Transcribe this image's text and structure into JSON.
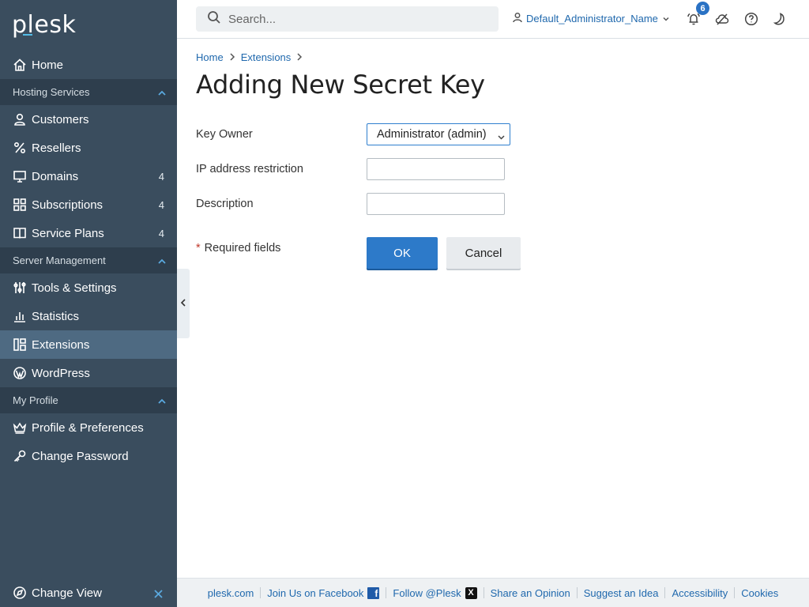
{
  "brand": {
    "logo_text": "plesk"
  },
  "sidebar": {
    "home": "Home",
    "sections": [
      {
        "label": "Hosting Services"
      },
      {
        "label": "Server Management"
      },
      {
        "label": "My Profile"
      }
    ],
    "hosting_items": [
      {
        "label": "Customers",
        "icon": "user-icon"
      },
      {
        "label": "Resellers",
        "icon": "percent-icon"
      },
      {
        "label": "Domains",
        "icon": "monitor-icon",
        "count": "4"
      },
      {
        "label": "Subscriptions",
        "icon": "grid-icon",
        "count": "4"
      },
      {
        "label": "Service Plans",
        "icon": "book-icon",
        "count": "4"
      }
    ],
    "server_items": [
      {
        "label": "Tools & Settings",
        "icon": "sliders-icon"
      },
      {
        "label": "Statistics",
        "icon": "bar-chart-icon"
      },
      {
        "label": "Extensions",
        "icon": "extensions-icon",
        "active": true
      },
      {
        "label": "WordPress",
        "icon": "wordpress-icon"
      }
    ],
    "profile_items": [
      {
        "label": "Profile & Preferences",
        "icon": "crown-icon"
      },
      {
        "label": "Change Password",
        "icon": "key-icon"
      }
    ],
    "change_view": "Change View"
  },
  "header": {
    "search_placeholder": "Search...",
    "user_name": "Default_Administrator_Name",
    "notification_count": "6"
  },
  "breadcrumb": [
    "Home",
    "Extensions"
  ],
  "page": {
    "title": "Adding New Secret Key",
    "form": {
      "key_owner_label": "Key Owner",
      "key_owner_value": "Administrator (admin)",
      "ip_label": "IP address restriction",
      "ip_value": "",
      "description_label": "Description",
      "description_value": "",
      "required_star": "*",
      "required_text": "Required fields",
      "ok_label": "OK",
      "cancel_label": "Cancel"
    }
  },
  "footer": {
    "links": [
      "plesk.com",
      "Join Us on Facebook",
      "Follow @Plesk",
      "Share an Opinion",
      "Suggest an Idea",
      "Accessibility",
      "Cookies"
    ],
    "fb_glyph": "f",
    "x_glyph": "X"
  },
  "colors": {
    "sidebar_bg": "#3a4d5e",
    "section_bg": "#2e3e4d",
    "active_bg": "#4e6a82",
    "accent": "#2d7ac9",
    "link": "#1f68ad"
  }
}
